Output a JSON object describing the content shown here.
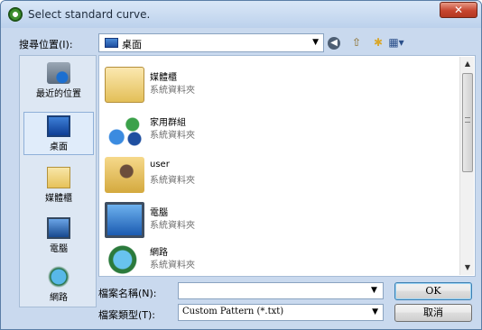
{
  "window": {
    "title": "Select standard curve."
  },
  "header": {
    "look_in_label": "搜尋位置(I):",
    "look_in_value": "桌面"
  },
  "places": [
    {
      "label": "最近的位置",
      "icon": "recent-places-icon"
    },
    {
      "label": "桌面",
      "icon": "desktop-icon",
      "selected": true
    },
    {
      "label": "媒體櫃",
      "icon": "libraries-icon"
    },
    {
      "label": "電腦",
      "icon": "computer-icon"
    },
    {
      "label": "網路",
      "icon": "network-icon"
    }
  ],
  "files": [
    {
      "name": "媒體櫃",
      "type": "系統資料夾",
      "icon": "libraries-icon"
    },
    {
      "name": "家用群組",
      "type": "系統資料夾",
      "icon": "homegroup-icon"
    },
    {
      "name": "user",
      "type": "系統資料夾",
      "icon": "user-folder-icon"
    },
    {
      "name": "電腦",
      "type": "系統資料夾",
      "icon": "computer-icon"
    },
    {
      "name": "網路",
      "type": "系統資料夾",
      "icon": "network-icon"
    }
  ],
  "footer": {
    "filename_label": "檔案名稱(N):",
    "filename_value": "",
    "filetype_label": "檔案類型(T):",
    "filetype_value": "Custom Pattern (*.txt)",
    "ok_label": "OK",
    "cancel_label": "取消"
  }
}
